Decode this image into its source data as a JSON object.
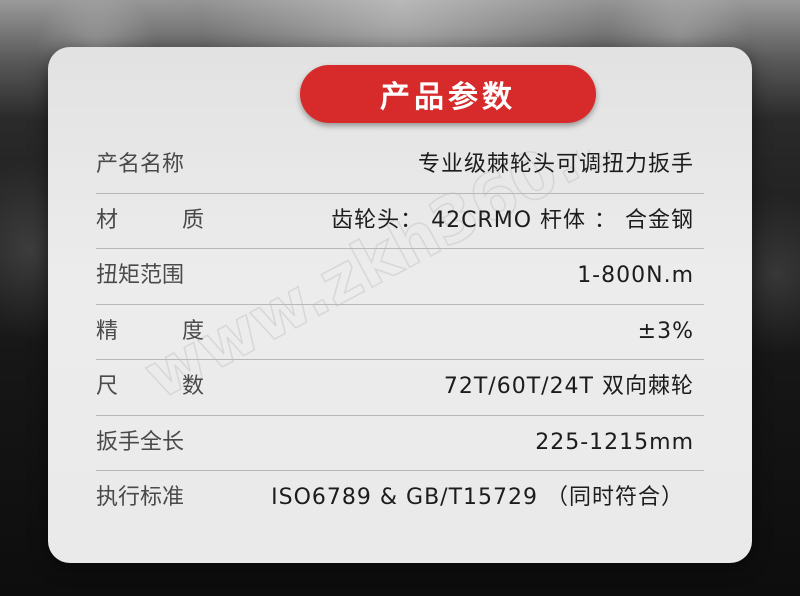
{
  "header": {
    "title": "产品参数"
  },
  "specs": [
    {
      "label_chars": [
        "产名名称"
      ],
      "label": "产名名称",
      "value": "专业级棘轮头可调扭力扳手"
    },
    {
      "label_chars": [
        "材",
        "质"
      ],
      "label": "材质",
      "value": "齿轮头： 42CRMO   杆体 ： 合金钢"
    },
    {
      "label_chars": [
        "扭矩范围"
      ],
      "label": "扭矩范围",
      "value": "1-800N.m"
    },
    {
      "label_chars": [
        "精",
        "度"
      ],
      "label": "精度",
      "value": "±3%"
    },
    {
      "label_chars": [
        "尺",
        "数"
      ],
      "label": "尺数",
      "value": "72T/60T/24T 双向棘轮"
    },
    {
      "label_chars": [
        "扳手全长"
      ],
      "label": "扳手全长",
      "value": "225-1215mm"
    },
    {
      "label_chars": [
        "执行标准"
      ],
      "label": "执行标准",
      "value": "ISO6789 &  GB/T15729 （同时符合）"
    }
  ],
  "watermark": {
    "text": "www.zkh360.com"
  },
  "colors": {
    "accent": "#d72b2b",
    "card": "#e8e8e8",
    "label_text": "#4a4a4a",
    "value_text": "#1c1c1c",
    "divider": "#b8b8b8"
  }
}
